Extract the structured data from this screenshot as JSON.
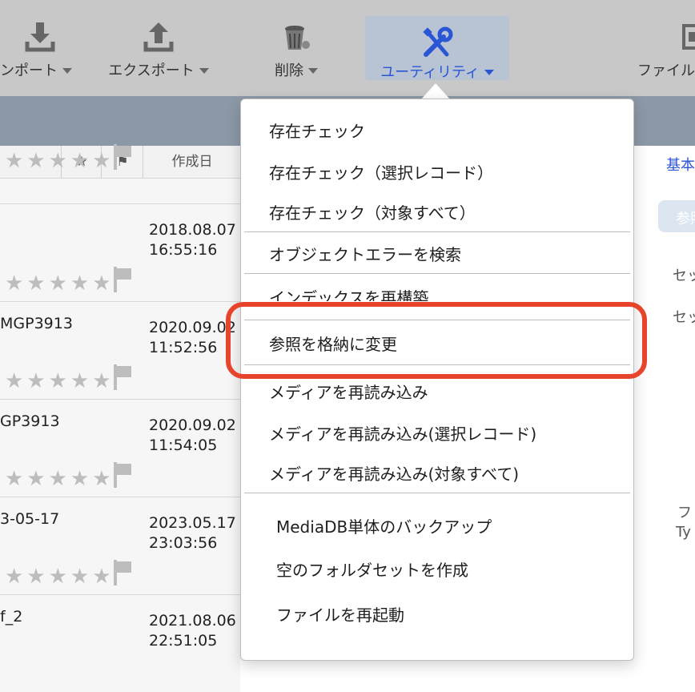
{
  "toolbar": {
    "import_label": "ンポート",
    "export_label": "エクスポート",
    "delete_label": "削除",
    "utility_label": "ユーティリティ",
    "file_label": "ファイル"
  },
  "list": {
    "headers": {
      "star": "★",
      "flag": "⚑",
      "created": "作成日"
    },
    "rows": [
      {
        "name": "",
        "date": "2018.08.07",
        "time": "16:55:16"
      },
      {
        "name": "MGP3913",
        "date": "2020.09.02",
        "time": "11:52:56"
      },
      {
        "name": "GP3913",
        "date": "2020.09.02",
        "time": "11:54:05"
      },
      {
        "name": "3-05-17",
        "date": "2023.05.17",
        "time": "23:03:56"
      },
      {
        "name": "f_2",
        "date": "2021.08.06",
        "time": "22:51:05"
      }
    ],
    "stars_text": "★★★★★"
  },
  "menu": {
    "items": [
      "存在チェック",
      "存在チェック（選択レコード）",
      "存在チェック（対象すべて）",
      "オブジェクトエラーを検索",
      "インデックスを再構築",
      "参照を格納に変更",
      "メディアを再読み込み",
      "メディアを再読み込み(選択レコード)",
      "メディアを再読み込み(対象すべて)",
      "MediaDB単体のバックアップ",
      "空のフォルダセットを作成",
      "ファイルを再起動"
    ]
  },
  "right_panel": {
    "tab": "基本",
    "pill": "参照",
    "line1": "セッ",
    "line2": "セッ",
    "line3": "フ",
    "line4": "Ty"
  },
  "colors": {
    "accent": "#2a56d6",
    "highlight": "#e8432b"
  }
}
